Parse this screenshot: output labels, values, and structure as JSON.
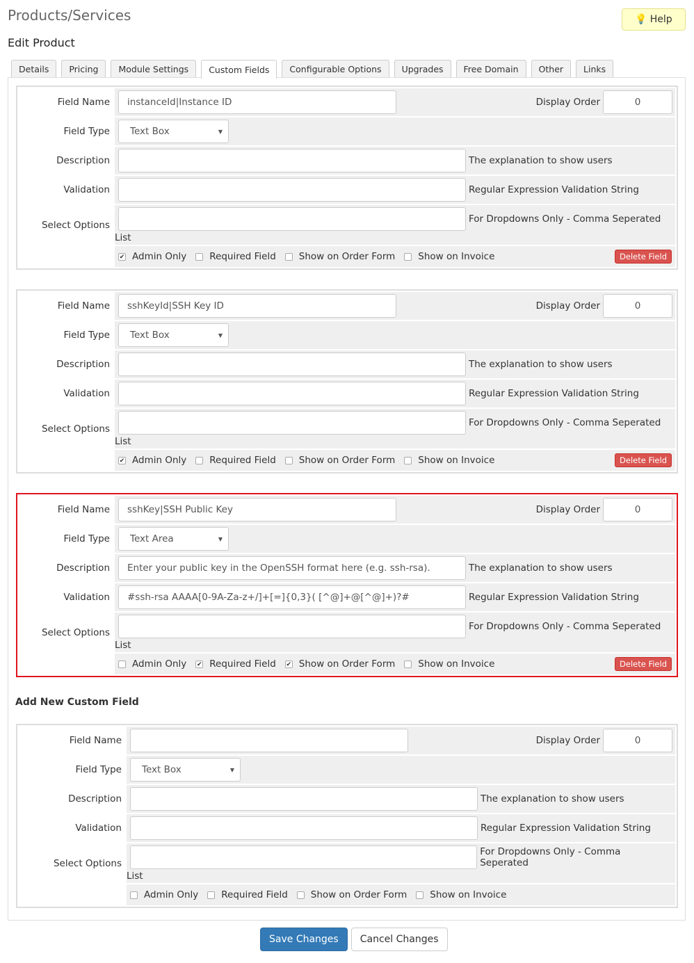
{
  "header": {
    "title": "Products/Services",
    "subtitle": "Edit Product",
    "help_label": "Help",
    "help_icon": "lightbulb-icon"
  },
  "tabs": [
    {
      "label": "Details"
    },
    {
      "label": "Pricing"
    },
    {
      "label": "Module Settings"
    },
    {
      "label": "Custom Fields",
      "active": true
    },
    {
      "label": "Configurable Options"
    },
    {
      "label": "Upgrades"
    },
    {
      "label": "Free Domain"
    },
    {
      "label": "Other"
    },
    {
      "label": "Links"
    }
  ],
  "labels": {
    "field_name": "Field Name",
    "display_order": "Display Order",
    "field_type": "Field Type",
    "description": "Description",
    "validation": "Validation",
    "select_options": "Select Options",
    "list": "List",
    "desc_hint": "The explanation to show users",
    "valid_hint": "Regular Expression Validation String",
    "opts_hint": "For Dropdowns Only - Comma Seperated",
    "admin_only": "Admin Only",
    "required": "Required Field",
    "show_order": "Show on Order Form",
    "show_invoice": "Show on Invoice",
    "delete": "Delete Field"
  },
  "fields": [
    {
      "name": "instanceId|Instance ID",
      "display_order": "0",
      "type": "Text Box",
      "description": "",
      "validation": "",
      "options": "",
      "admin_only": true,
      "required": false,
      "show_order": false,
      "show_invoice": false
    },
    {
      "name": "sshKeyId|SSH Key ID",
      "display_order": "0",
      "type": "Text Box",
      "description": "",
      "validation": "",
      "options": "",
      "admin_only": true,
      "required": false,
      "show_order": false,
      "show_invoice": false
    },
    {
      "name": "sshKey|SSH Public Key",
      "display_order": "0",
      "type": "Text Area",
      "description": "Enter your public key in the OpenSSH format here (e.g. ssh-rsa).",
      "validation": "#ssh-rsa AAAA[0-9A-Za-z+/]+[=]{0,3}( [^@]+@[^@]+)?#",
      "options": "",
      "admin_only": false,
      "required": true,
      "show_order": true,
      "show_invoice": false,
      "highlighted": true
    }
  ],
  "new_field": {
    "heading": "Add New Custom Field",
    "name": "",
    "display_order": "0",
    "type": "Text Box",
    "description": "",
    "validation": "",
    "options": "",
    "admin_only": false,
    "required": false,
    "show_order": false,
    "show_invoice": false
  },
  "actions": {
    "save": "Save Changes",
    "cancel": "Cancel Changes"
  },
  "colors": {
    "highlight": "#e0141e",
    "save": "#337ab7",
    "delete": "#d9534f"
  }
}
